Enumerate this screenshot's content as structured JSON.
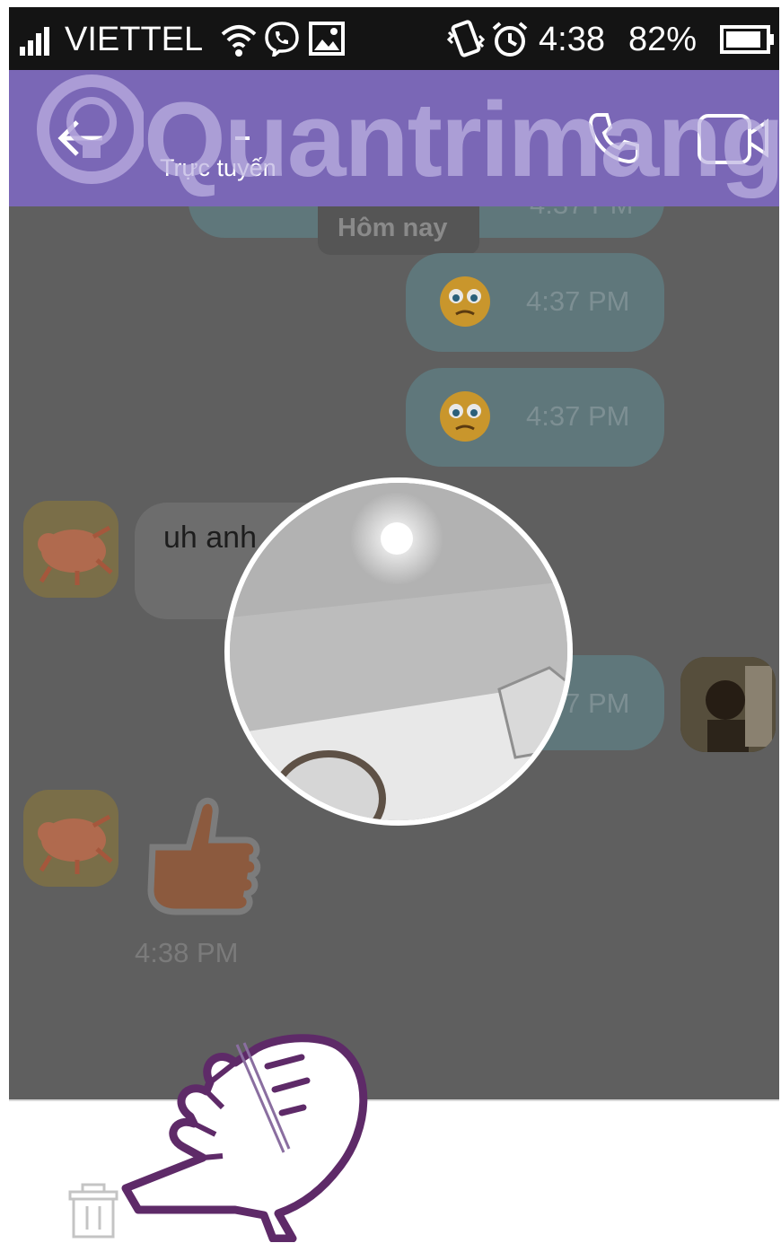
{
  "status_bar": {
    "carrier": "VIETTEL",
    "time": "4:38",
    "battery": "82%",
    "icons": [
      "signal-icon",
      "wifi-icon",
      "viber-icon",
      "image-icon",
      "vibrate-icon",
      "alarm-icon",
      "battery-icon"
    ]
  },
  "app_bar": {
    "status": "Trực tuyến",
    "watermark": "Quantrimang",
    "icons": [
      "back-arrow-icon",
      "phone-icon",
      "video-call-icon"
    ]
  },
  "chat": {
    "date_label": "Hôm nay",
    "top_partial_time": "4:37 PM",
    "messages": [
      {
        "type": "sticker-out",
        "time": "4:37 PM"
      },
      {
        "type": "sticker-out",
        "time": "4:37 PM"
      },
      {
        "type": "text-in",
        "text": "uh anh"
      },
      {
        "type": "out",
        "time": "4:37 PM"
      },
      {
        "type": "sticker-in",
        "time": "4:38 PM"
      }
    ]
  },
  "video_preview": {
    "icon": "video-preview"
  },
  "bottom_bar": {
    "icons": [
      "trash-icon",
      "pointing-hand-icon"
    ]
  },
  "colors": {
    "header": "#7a67b6",
    "chat_bg": "#5f5f5f",
    "bubble_out": "#5f777b",
    "hand_outline": "#5e2a68"
  }
}
